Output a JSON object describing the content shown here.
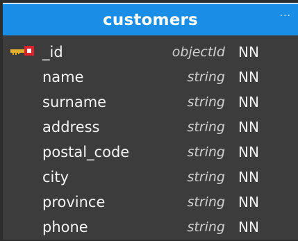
{
  "table": {
    "title": "customers",
    "menu_icon": "ellipsis-icon",
    "menu_glyph": "···",
    "colors": {
      "header": "#1a8de6",
      "body": "#3c3c3c",
      "key_gold": "#e0b02a",
      "key_red": "#e0202a"
    },
    "fields": [
      {
        "name": "_id",
        "type": "objectId",
        "flag": "NN",
        "primary_key": true
      },
      {
        "name": "name",
        "type": "string",
        "flag": "NN",
        "primary_key": false
      },
      {
        "name": "surname",
        "type": "string",
        "flag": "NN",
        "primary_key": false
      },
      {
        "name": "address",
        "type": "string",
        "flag": "NN",
        "primary_key": false
      },
      {
        "name": "postal_code",
        "type": "string",
        "flag": "NN",
        "primary_key": false
      },
      {
        "name": "city",
        "type": "string",
        "flag": "NN",
        "primary_key": false
      },
      {
        "name": "province",
        "type": "string",
        "flag": "NN",
        "primary_key": false
      },
      {
        "name": "phone",
        "type": "string",
        "flag": "NN",
        "primary_key": false
      }
    ]
  }
}
